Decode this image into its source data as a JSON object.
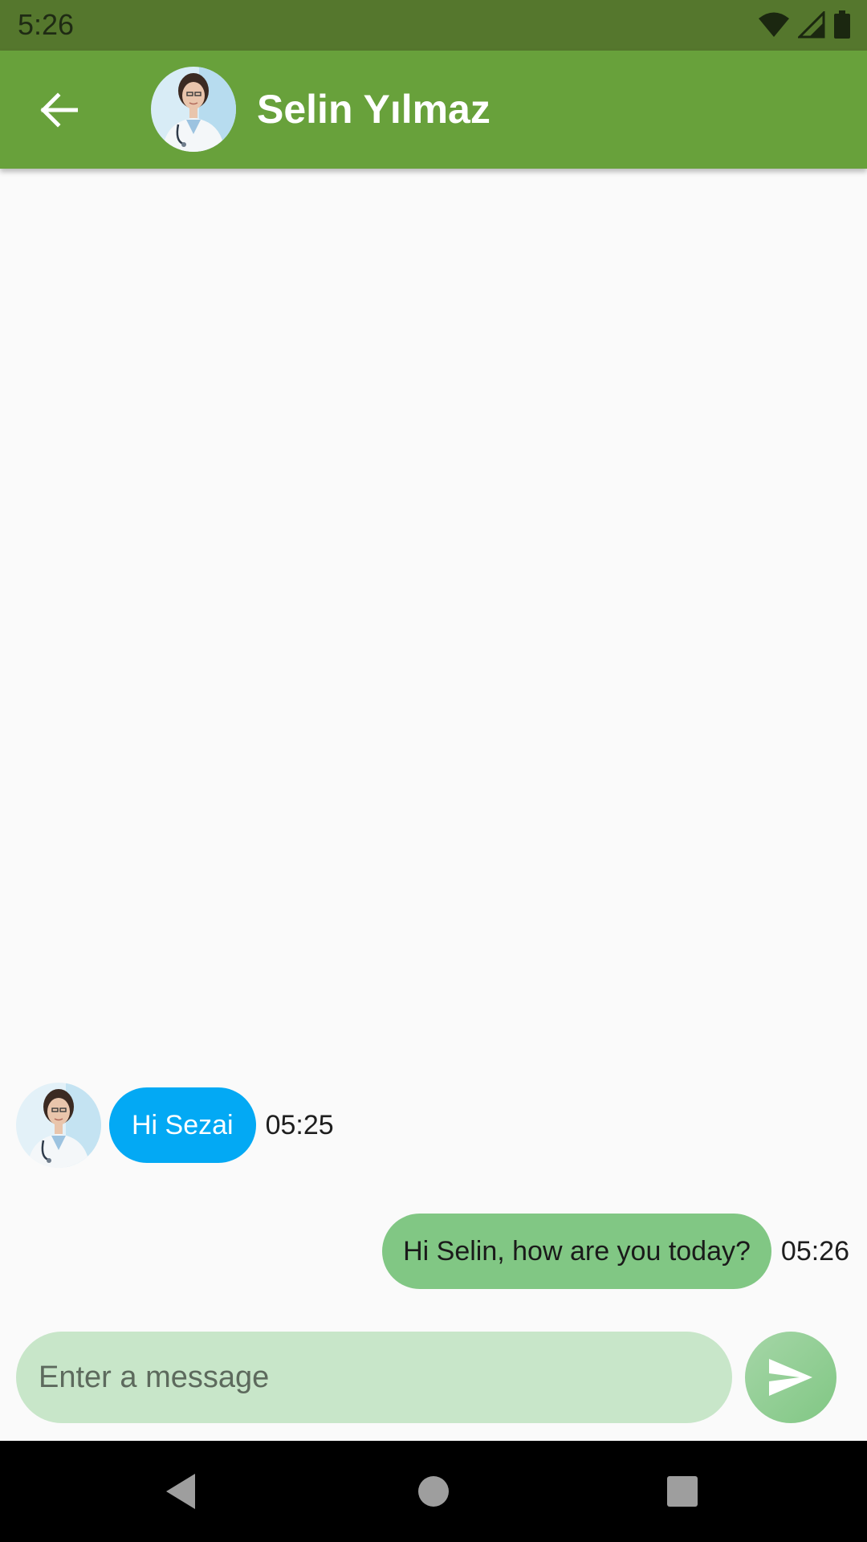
{
  "status_bar": {
    "time": "5:26",
    "icons": [
      "wifi-icon",
      "cellular-signal-icon",
      "battery-icon"
    ]
  },
  "header": {
    "back_icon": "arrow-left-icon",
    "contact_name": "Selin Yılmaz",
    "avatar": "doctor-avatar"
  },
  "messages": [
    {
      "direction": "incoming",
      "text": "Hi Sezai",
      "time": "05:25",
      "bubble_color": "#03a9f4"
    },
    {
      "direction": "outgoing",
      "text": "Hi Selin, how are you today?",
      "time": "05:26",
      "bubble_color": "#81c784"
    }
  ],
  "composer": {
    "placeholder": "Enter a message",
    "value": "",
    "send_icon": "send-icon"
  },
  "nav_bar": {
    "icons": [
      "back-triangle-icon",
      "home-circle-icon",
      "recents-square-icon"
    ]
  },
  "colors": {
    "status_bar": "#55772d",
    "app_bar": "#68a13b",
    "input_background": "#c8e6c9"
  }
}
